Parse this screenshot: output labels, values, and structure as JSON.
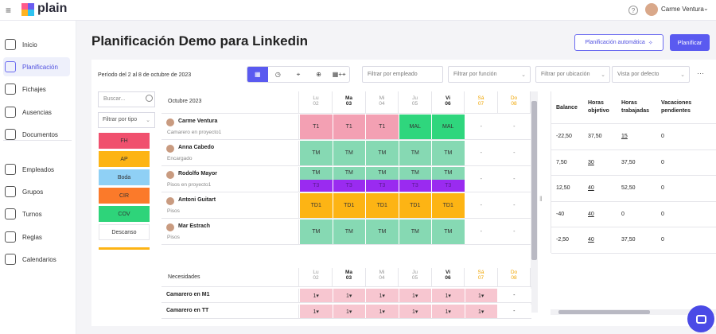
{
  "app": {
    "name": "plain",
    "user": "Carme Ventura"
  },
  "sidebar": {
    "items": [
      {
        "label": "Inicio",
        "icon": "home-icon"
      },
      {
        "label": "Planificación",
        "icon": "calendar-grid-icon",
        "active": true
      },
      {
        "label": "Fichajes",
        "icon": "clock-icon"
      },
      {
        "label": "Ausencias",
        "icon": "external-icon"
      },
      {
        "label": "Documentos",
        "icon": "folder-icon"
      },
      {
        "label": "Empleados",
        "icon": "person-icon"
      },
      {
        "label": "Grupos",
        "icon": "group-icon"
      },
      {
        "label": "Turnos",
        "icon": "refresh-icon"
      },
      {
        "label": "Reglas",
        "icon": "sliders-icon"
      },
      {
        "label": "Calendarios",
        "icon": "calendar-icon"
      }
    ]
  },
  "page": {
    "title": "Planificación Demo para Linkedin",
    "auto_button": "Planificación automática",
    "plan_button": "Planificar",
    "period": "Período del 2 al 8 de octubre de 2023"
  },
  "filters": {
    "employee": "Filtrar por empleado",
    "function": "Filtrar por función",
    "location": "Filtrar por ubicación",
    "view": "Vista por defecto",
    "search": "Buscar...",
    "type": "Filtrar por tipo"
  },
  "view_toggle": [
    "▦",
    "◷",
    "⌖",
    "⊕",
    "▦+⌖"
  ],
  "types": [
    {
      "label": "FH",
      "color": "#f0506e"
    },
    {
      "label": "AP",
      "color": "#fdb414"
    },
    {
      "label": "Boda",
      "color": "#8fd0f5"
    },
    {
      "label": "CIR",
      "color": "#fb7a2a"
    },
    {
      "label": "COV",
      "color": "#2ed47a"
    },
    {
      "label": "Descanso",
      "color": "#ffffff"
    }
  ],
  "grid": {
    "month": "Octubre 2023",
    "days": [
      {
        "d": "Lu",
        "n": "02",
        "style": "muted"
      },
      {
        "d": "Ma",
        "n": "03",
        "style": "strong"
      },
      {
        "d": "Mi",
        "n": "04",
        "style": "muted"
      },
      {
        "d": "Ju",
        "n": "05",
        "style": "muted"
      },
      {
        "d": "Vi",
        "n": "06",
        "style": "strong"
      },
      {
        "d": "Sá",
        "n": "07",
        "style": "weekend"
      },
      {
        "d": "Do",
        "n": "08",
        "style": "weekend"
      }
    ],
    "employees": [
      {
        "name": "Carme Ventura",
        "role": "Camarero en proyecto1",
        "cells": [
          [
            "T1",
            "#f3a0b3"
          ],
          [
            "T1",
            "#f3a0b3"
          ],
          [
            "T1",
            "#f3a0b3"
          ],
          [
            "MAL",
            "#2fd67d"
          ],
          [
            "MAL",
            "#2fd67d"
          ],
          [
            "-",
            ""
          ],
          [
            "-",
            ""
          ]
        ]
      },
      {
        "name": "Anna Cabedo",
        "role": "Encargado",
        "cells": [
          [
            "TM",
            "#86d9b3"
          ],
          [
            "TM",
            "#86d9b3"
          ],
          [
            "TM",
            "#86d9b3"
          ],
          [
            "TM",
            "#86d9b3"
          ],
          [
            "TM",
            "#86d9b3"
          ],
          [
            "-",
            ""
          ],
          [
            "-",
            ""
          ]
        ]
      },
      {
        "name": "Rodolfo Mayor",
        "role": "Pisos en proyecto1",
        "cells": [
          [
            "TM",
            "#86d9b3"
          ],
          [
            "TM",
            "#86d9b3"
          ],
          [
            "TM",
            "#86d9b3"
          ],
          [
            "TM",
            "#86d9b3"
          ],
          [
            "TM",
            "#86d9b3"
          ],
          [
            "-",
            ""
          ],
          [
            "-",
            ""
          ]
        ],
        "cells2": [
          [
            "T3",
            "#9a2bf0"
          ],
          [
            "T3",
            "#9a2bf0"
          ],
          [
            "T3",
            "#9a2bf0"
          ],
          [
            "T3",
            "#9a2bf0"
          ],
          [
            "T3",
            "#9a2bf0"
          ]
        ]
      },
      {
        "name": "Antoni Guitart",
        "role": "Pisos",
        "cells": [
          [
            "TD1",
            "#fdb414"
          ],
          [
            "TD1",
            "#fdb414"
          ],
          [
            "TD1",
            "#fdb414"
          ],
          [
            "TD1",
            "#fdb414"
          ],
          [
            "TD1",
            "#fdb414"
          ],
          [
            "-",
            ""
          ],
          [
            "-",
            ""
          ]
        ]
      },
      {
        "name": "Mar Estrach",
        "role": "Pisos",
        "cells": [
          [
            "TM",
            "#86d9b3"
          ],
          [
            "TM",
            "#86d9b3"
          ],
          [
            "TM",
            "#86d9b3"
          ],
          [
            "TM",
            "#86d9b3"
          ],
          [
            "TM",
            "#86d9b3"
          ],
          [
            "-",
            ""
          ],
          [
            "-",
            ""
          ]
        ]
      }
    ]
  },
  "needs": {
    "title": "Necesidades",
    "rows": [
      {
        "name": "Camarero en M1",
        "values": [
          "1▾",
          "1▾",
          "1▾",
          "1▾",
          "1▾",
          "1▾",
          "-"
        ]
      },
      {
        "name": "Camarero en TT",
        "values": [
          "1▾",
          "1▾",
          "1▾",
          "1▾",
          "1▾",
          "1▾",
          "-"
        ]
      }
    ]
  },
  "summary": {
    "headers": [
      "Balance",
      "Horas objetivo",
      "Horas trabajadas",
      "Vacaciones pendientes"
    ],
    "rows": [
      [
        "-22,50",
        "37,50",
        "15",
        "0"
      ],
      [
        "7,50",
        "30",
        "37,50",
        "0"
      ],
      [
        "12,50",
        "40",
        "52,50",
        "0"
      ],
      [
        "-40",
        "40",
        "0",
        "0"
      ],
      [
        "-2,50",
        "40",
        "37,50",
        "0"
      ]
    ]
  }
}
